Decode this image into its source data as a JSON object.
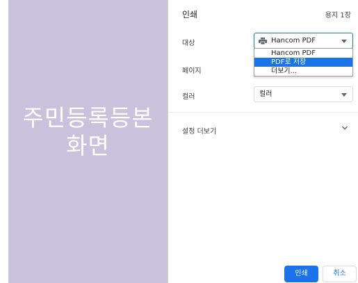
{
  "preview": {
    "text_line1": "주민등록등본",
    "text_line2": "화면"
  },
  "dialog": {
    "title": "인쇄",
    "sheet_count": "용지 1장"
  },
  "destination": {
    "label": "대상",
    "selected": "Hancom PDF",
    "icon": "printer-icon",
    "options": [
      "Hancom PDF",
      "PDF로 저장",
      "더보기..."
    ],
    "highlighted_index": 1
  },
  "pages": {
    "label": "페이지"
  },
  "color": {
    "label": "컬러",
    "selected": "컬러"
  },
  "more_settings": {
    "label": "설정 더보기",
    "icon": "chevron-down-icon"
  },
  "buttons": {
    "print": "인쇄",
    "cancel": "취소"
  },
  "colors": {
    "accent": "#1a73e8",
    "preview_bg": "#c8c2dc"
  }
}
